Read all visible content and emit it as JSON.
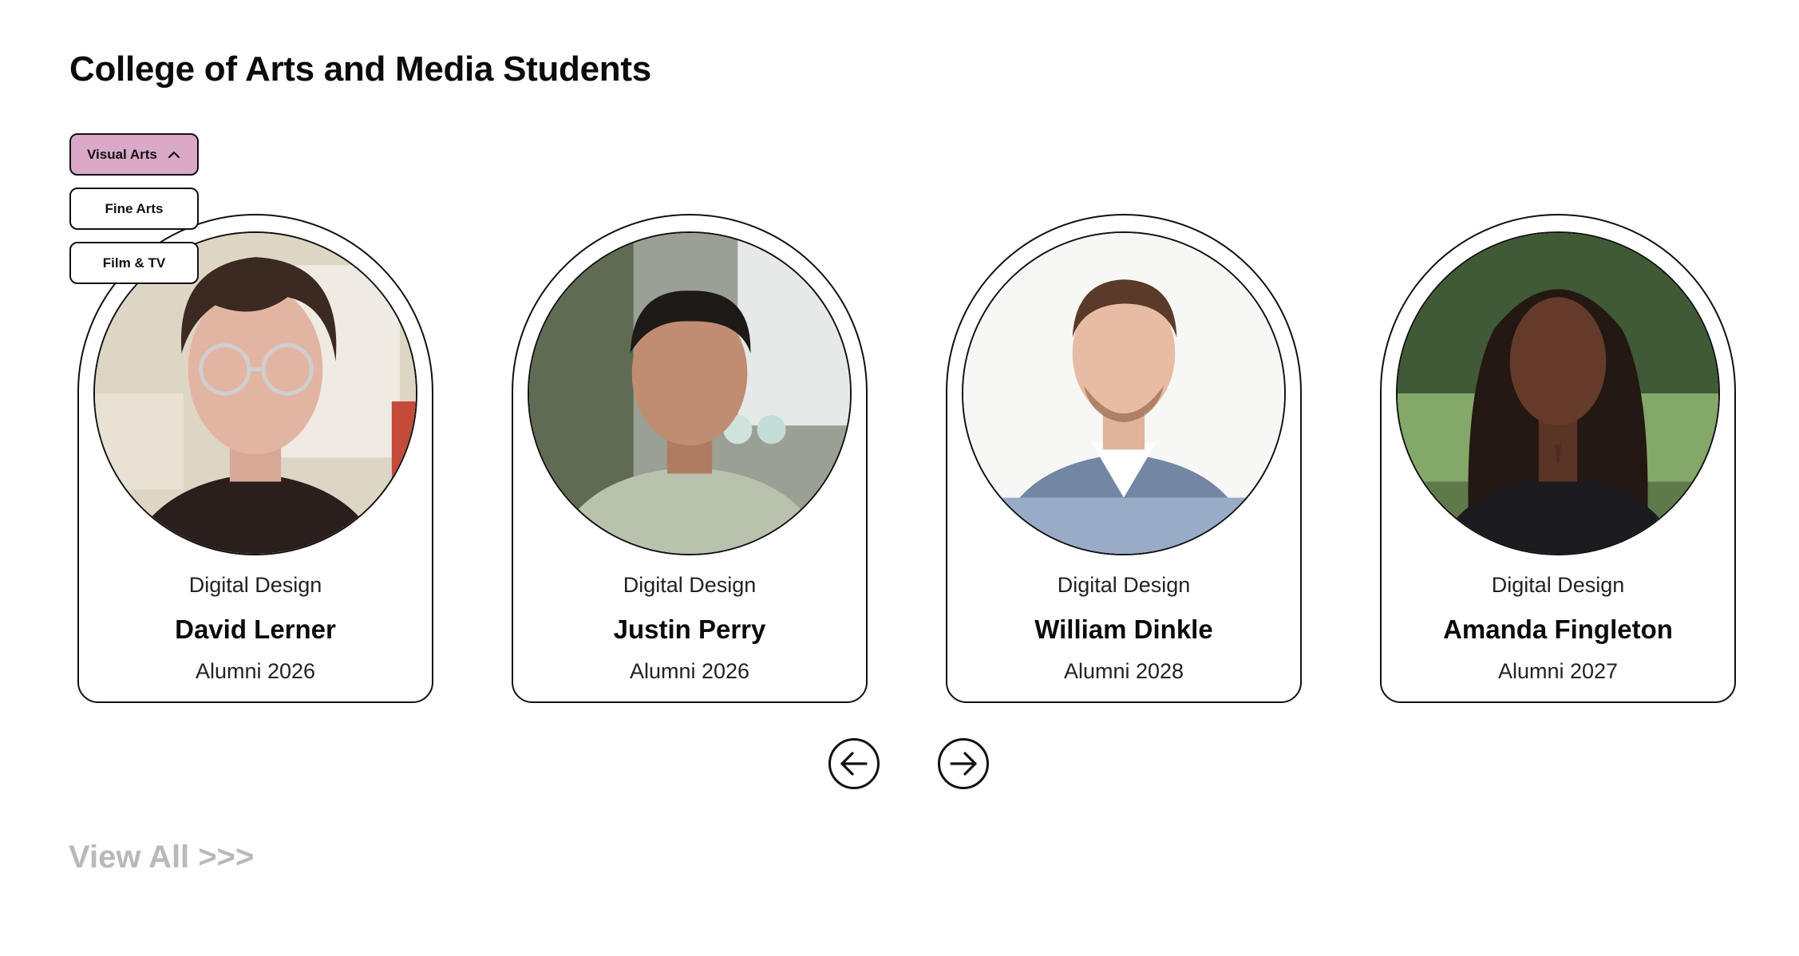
{
  "page": {
    "title": "College of Arts and Media Students"
  },
  "filter": {
    "selected": "Visual Arts",
    "options": [
      "Fine Arts",
      "Film & TV"
    ],
    "selected_color": "#d9a9c7"
  },
  "students": [
    {
      "program": "Digital Design",
      "name": "David Lerner",
      "alumni": "Alumni 2026"
    },
    {
      "program": "Digital Design",
      "name": "Justin Perry",
      "alumni": "Alumni 2026"
    },
    {
      "program": "Digital Design",
      "name": "William Dinkle",
      "alumni": "Alumni 2028"
    },
    {
      "program": "Digital Design",
      "name": "Amanda Fingleton",
      "alumni": "Alumni 2027"
    }
  ],
  "nav": {
    "prev_icon": "arrow-left-icon",
    "next_icon": "arrow-right-icon"
  },
  "view_all": {
    "label": "View All >>>",
    "color": "#b9b9b9"
  }
}
